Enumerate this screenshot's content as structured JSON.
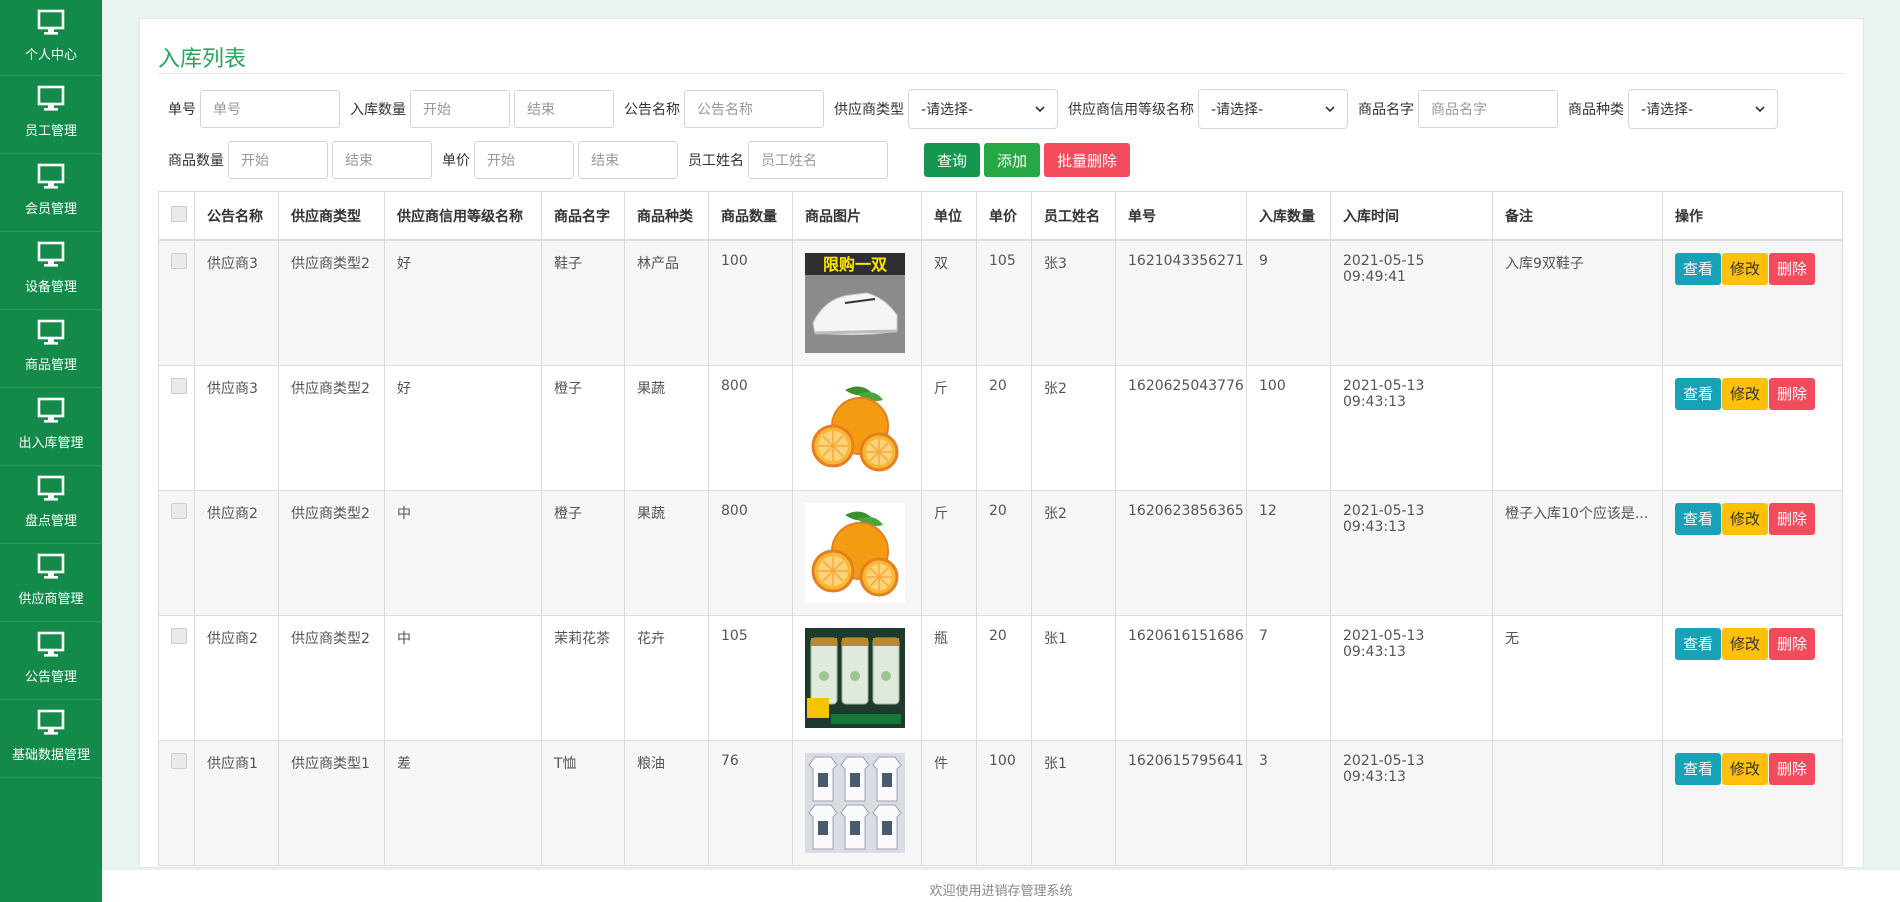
{
  "sidebar": {
    "items": [
      {
        "label": "个人中心"
      },
      {
        "label": "员工管理"
      },
      {
        "label": "会员管理"
      },
      {
        "label": "设备管理"
      },
      {
        "label": "商品管理"
      },
      {
        "label": "出入库管理"
      },
      {
        "label": "盘点管理"
      },
      {
        "label": "供应商管理"
      },
      {
        "label": "公告管理"
      },
      {
        "label": "基础数据管理"
      }
    ]
  },
  "page": {
    "title": "入库列表"
  },
  "filters": {
    "danhao_label": "单号",
    "danhao_placeholder": "单号",
    "qty_label": "入库数量",
    "qty_start": "开始",
    "qty_end": "结束",
    "notice_label": "公告名称",
    "notice_placeholder": "公告名称",
    "stype_label": "供应商类型",
    "stype_value": "-请选择-",
    "credit_label": "供应商信用等级名称",
    "credit_value": "-请选择-",
    "pname_label": "商品名字",
    "pname_placeholder": "商品名字",
    "ptype_label": "商品种类",
    "ptype_value": "-请选择-",
    "pqty_label": "商品数量",
    "pqty_start": "开始",
    "pqty_end": "结束",
    "price_label": "单价",
    "price_start": "开始",
    "price_end": "结束",
    "staff_label": "员工姓名",
    "staff_placeholder": "员工姓名",
    "query_btn": "查询",
    "add_btn": "添加",
    "batch_delete_btn": "批量删除"
  },
  "table": {
    "headers": [
      "公告名称",
      "供应商类型",
      "供应商信用等级名称",
      "商品名字",
      "商品种类",
      "商品数量",
      "商品图片",
      "单位",
      "单价",
      "员工姓名",
      "单号",
      "入库数量",
      "入库时间",
      "备注",
      "操作"
    ],
    "rows": [
      {
        "notice": "供应商3",
        "stype": "供应商类型2",
        "credit": "好",
        "pname": "鞋子",
        "ptype": "林产品",
        "pqty": "100",
        "image": "shoe",
        "image_text": "限购一双",
        "unit": "双",
        "price": "105",
        "staff": "张3",
        "no": "1621043356271",
        "qty": "9",
        "time": "2021-05-15 09:49:41",
        "remark": "入库9双鞋子"
      },
      {
        "notice": "供应商3",
        "stype": "供应商类型2",
        "credit": "好",
        "pname": "橙子",
        "ptype": "果蔬",
        "pqty": "800",
        "image": "orange",
        "unit": "斤",
        "price": "20",
        "staff": "张2",
        "no": "1620625043776",
        "qty": "100",
        "time": "2021-05-13 09:43:13",
        "remark": ""
      },
      {
        "notice": "供应商2",
        "stype": "供应商类型2",
        "credit": "中",
        "pname": "橙子",
        "ptype": "果蔬",
        "pqty": "800",
        "image": "orange",
        "unit": "斤",
        "price": "20",
        "staff": "张2",
        "no": "1620623856365",
        "qty": "12",
        "time": "2021-05-13 09:43:13",
        "remark": "橙子入库10个应该是..."
      },
      {
        "notice": "供应商2",
        "stype": "供应商类型2",
        "credit": "中",
        "pname": "茉莉花茶",
        "ptype": "花卉",
        "pqty": "105",
        "image": "tea",
        "unit": "瓶",
        "price": "20",
        "staff": "张1",
        "no": "1620616151686",
        "qty": "7",
        "time": "2021-05-13 09:43:13",
        "remark": "无"
      },
      {
        "notice": "供应商1",
        "stype": "供应商类型1",
        "credit": "差",
        "pname": "T恤",
        "ptype": "粮油",
        "pqty": "76",
        "image": "tshirt",
        "unit": "件",
        "price": "100",
        "staff": "张1",
        "no": "1620615795641",
        "qty": "3",
        "time": "2021-05-13 09:43:13",
        "remark": ""
      }
    ],
    "actions": {
      "view": "查看",
      "edit": "修改",
      "delete": "删除"
    }
  },
  "footer": {
    "text": "欢迎使用进销存管理系统"
  },
  "colors": {
    "sidebar": "#148a4a",
    "accent": "#2aa55a",
    "view": "#17a2b8",
    "edit": "#ffc107",
    "delete": "#f24b5b"
  }
}
